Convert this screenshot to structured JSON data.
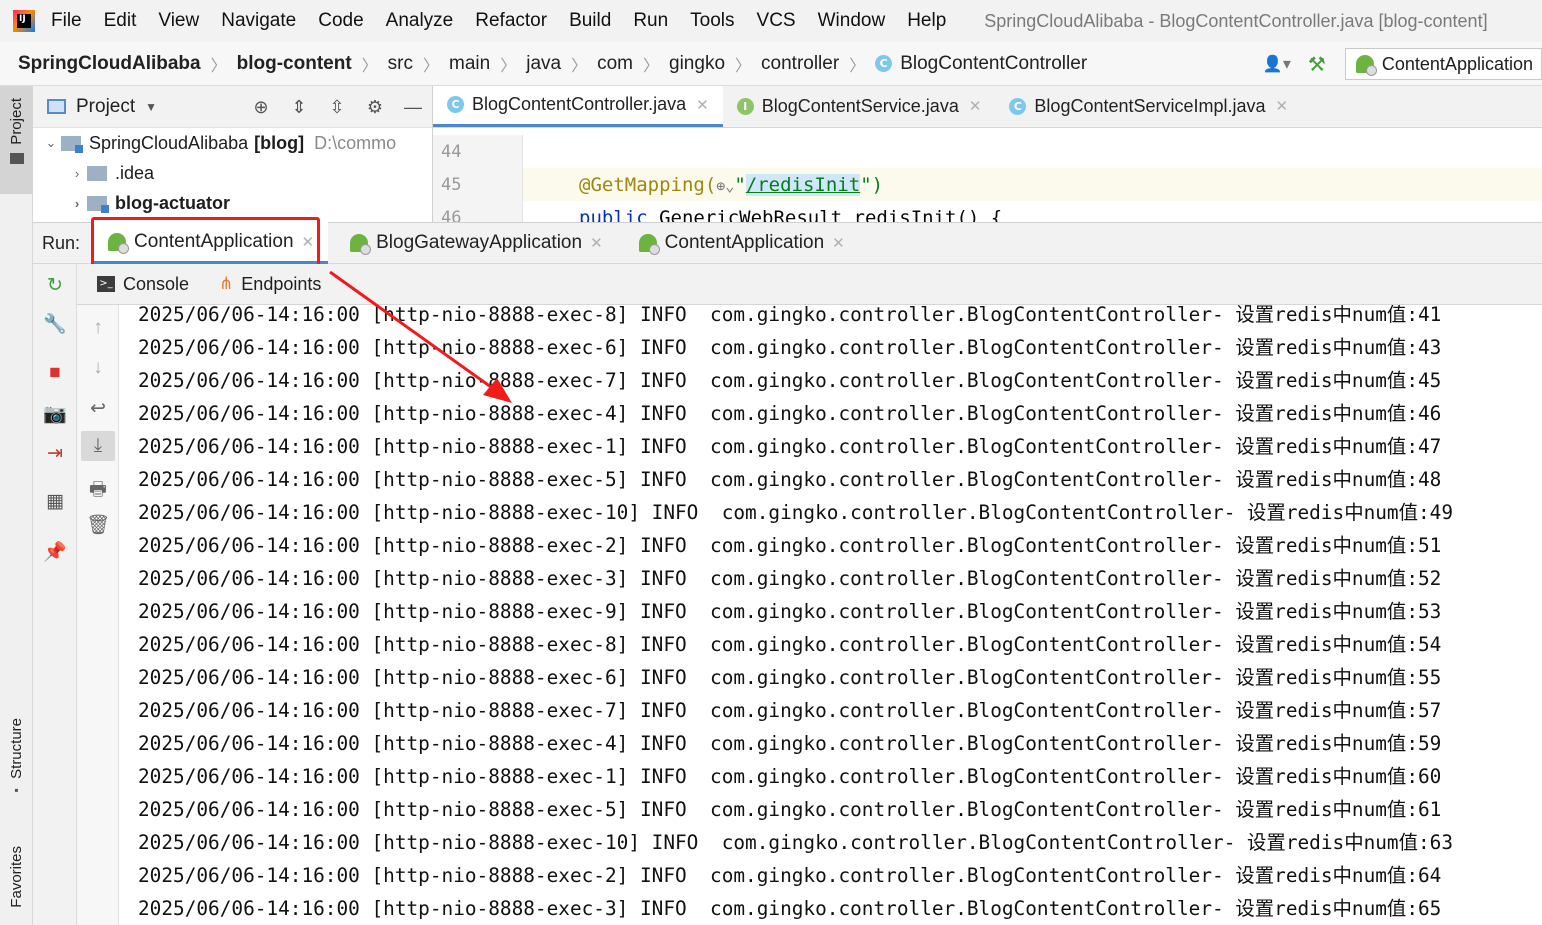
{
  "menubar": {
    "items": [
      "File",
      "Edit",
      "View",
      "Navigate",
      "Code",
      "Analyze",
      "Refactor",
      "Build",
      "Run",
      "Tools",
      "VCS",
      "Window",
      "Help"
    ],
    "window_title": "SpringCloudAlibaba - BlogContentController.java [blog-content]"
  },
  "navbar": {
    "crumbs": [
      "SpringCloudAlibaba",
      "blog-content",
      "src",
      "main",
      "java",
      "com",
      "gingko",
      "controller",
      "BlogContentController"
    ],
    "class_badge": "C",
    "run_config": "ContentApplication"
  },
  "stripe": {
    "project": "Project",
    "structure": "Structure",
    "favorites": "Favorites"
  },
  "project_panel": {
    "title": "Project",
    "tree": [
      {
        "label": "SpringCloudAlibaba",
        "tag": "[blog]",
        "path": "D:\\commo"
      },
      {
        "label": ".idea"
      },
      {
        "label": "blog-actuator"
      }
    ]
  },
  "editor": {
    "tabs": [
      {
        "label": "BlogContentController.java",
        "badge": "C"
      },
      {
        "label": "BlogContentService.java",
        "badge": "I"
      },
      {
        "label": "BlogContentServiceImpl.java",
        "badge": "C"
      }
    ],
    "lines": [
      {
        "number": "44"
      },
      {
        "number": "45",
        "annotation": "@GetMapping(",
        "quote_open": "\"",
        "path": "/redisInit",
        "quote_close": "\")"
      },
      {
        "number": "46",
        "keyword": "public",
        "rest": " GenericWebResult redisInit() {"
      }
    ]
  },
  "run_panel": {
    "label": "Run:",
    "tabs": [
      "ContentApplication",
      "BlogGatewayApplication",
      "ContentApplication"
    ],
    "console_tab": "Console",
    "endpoints_tab": "Endpoints"
  },
  "console": {
    "lines": [
      "2025/06/06-14:16:00 [http-nio-8888-exec-8] INFO  com.gingko.controller.BlogContentController- 设置redis中num值:41",
      "2025/06/06-14:16:00 [http-nio-8888-exec-6] INFO  com.gingko.controller.BlogContentController- 设置redis中num值:43",
      "2025/06/06-14:16:00 [http-nio-8888-exec-7] INFO  com.gingko.controller.BlogContentController- 设置redis中num值:45",
      "2025/06/06-14:16:00 [http-nio-8888-exec-4] INFO  com.gingko.controller.BlogContentController- 设置redis中num值:46",
      "2025/06/06-14:16:00 [http-nio-8888-exec-1] INFO  com.gingko.controller.BlogContentController- 设置redis中num值:47",
      "2025/06/06-14:16:00 [http-nio-8888-exec-5] INFO  com.gingko.controller.BlogContentController- 设置redis中num值:48",
      "2025/06/06-14:16:00 [http-nio-8888-exec-10] INFO  com.gingko.controller.BlogContentController- 设置redis中num值:49",
      "2025/06/06-14:16:00 [http-nio-8888-exec-2] INFO  com.gingko.controller.BlogContentController- 设置redis中num值:51",
      "2025/06/06-14:16:00 [http-nio-8888-exec-3] INFO  com.gingko.controller.BlogContentController- 设置redis中num值:52",
      "2025/06/06-14:16:00 [http-nio-8888-exec-9] INFO  com.gingko.controller.BlogContentController- 设置redis中num值:53",
      "2025/06/06-14:16:00 [http-nio-8888-exec-8] INFO  com.gingko.controller.BlogContentController- 设置redis中num值:54",
      "2025/06/06-14:16:00 [http-nio-8888-exec-6] INFO  com.gingko.controller.BlogContentController- 设置redis中num值:55",
      "2025/06/06-14:16:00 [http-nio-8888-exec-7] INFO  com.gingko.controller.BlogContentController- 设置redis中num值:57",
      "2025/06/06-14:16:00 [http-nio-8888-exec-4] INFO  com.gingko.controller.BlogContentController- 设置redis中num值:59",
      "2025/06/06-14:16:00 [http-nio-8888-exec-1] INFO  com.gingko.controller.BlogContentController- 设置redis中num值:60",
      "2025/06/06-14:16:00 [http-nio-8888-exec-5] INFO  com.gingko.controller.BlogContentController- 设置redis中num值:61",
      "2025/06/06-14:16:00 [http-nio-8888-exec-10] INFO  com.gingko.controller.BlogContentController- 设置redis中num值:63",
      "2025/06/06-14:16:00 [http-nio-8888-exec-2] INFO  com.gingko.controller.BlogContentController- 设置redis中num值:64",
      "2025/06/06-14:16:00 [http-nio-8888-exec-3] INFO  com.gingko.controller.BlogContentController- 设置redis中num值:65"
    ]
  },
  "colors": {
    "annotation_highlight": "#f21b1b",
    "active_tab_underline": "#4a88c7",
    "spring_green": "#6db33f"
  }
}
